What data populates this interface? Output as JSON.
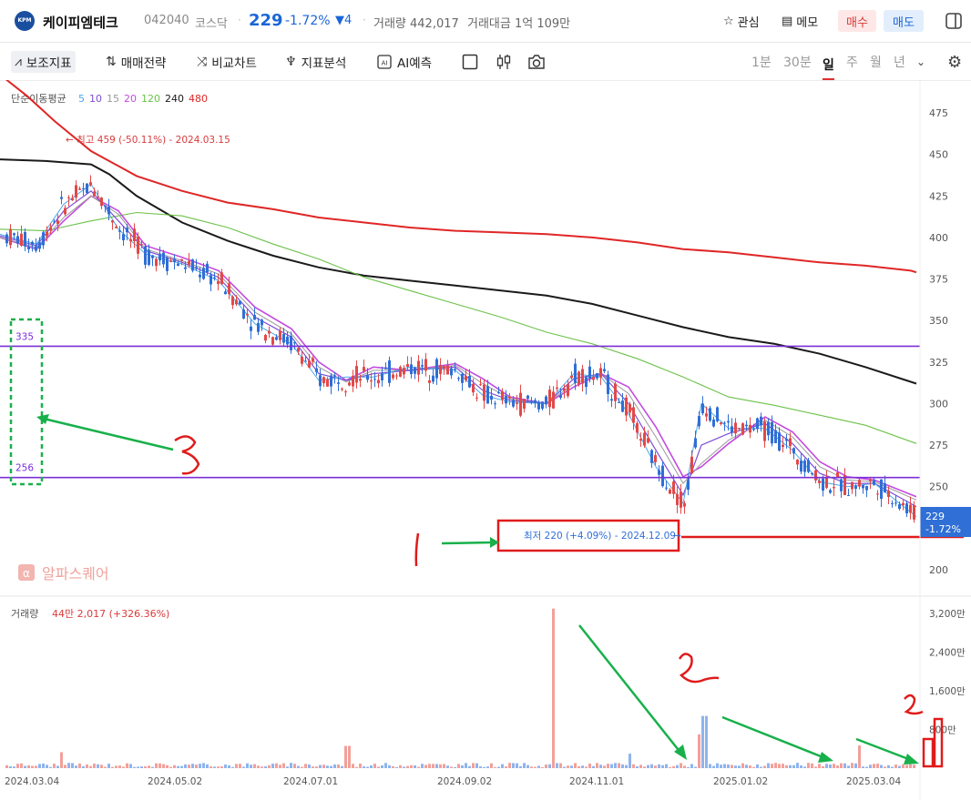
{
  "header": {
    "name": "케이피엠테크",
    "code": "042040",
    "market": "코스닥",
    "price": "229",
    "change_pct": "-1.72%",
    "change": "▼4",
    "volume_label": "거래량 442,017",
    "amount_label": "거래대금 1억 109만",
    "fav_label": "관심",
    "memo_label": "메모",
    "buy_label": "매수",
    "sell_label": "매도",
    "logo_text": "KPM"
  },
  "toolbar": {
    "indicators": "보조지표",
    "strategy": "매매전략",
    "compare": "비교차트",
    "analysis": "지표분석",
    "ai_predict": "AI예측",
    "periods": [
      "1분",
      "30분",
      "일",
      "주",
      "월",
      "년"
    ],
    "selected_period": "일"
  },
  "colors": {
    "up": "#e34848",
    "down": "#2f6fd6",
    "ma5": "#4aa8e8",
    "ma10": "#7c4dd8",
    "ma15": "#9a9a9a",
    "ma20": "#c34be0",
    "ma120": "#6cc24a",
    "ma240": "#1a1a1a",
    "ma480": "#e02626",
    "hline": "#7b2fd6"
  },
  "chart_data": {
    "type": "candlestick",
    "legend": {
      "title": "단순이동평균",
      "periods": [
        "5",
        "10",
        "15",
        "20",
        "120",
        "240",
        "480"
      ]
    },
    "y_ticks": [
      475,
      450,
      425,
      400,
      375,
      350,
      325,
      300,
      275,
      250,
      225,
      200
    ],
    "ylim": [
      186,
      484
    ],
    "x_ticks": [
      "2024.03.04",
      "2024.05.02",
      "2024.07.01",
      "2024.09.02",
      "2024.11.01",
      "2025.01.02",
      "2025.03.04"
    ],
    "high_label": "최고 459 (-50.11%) - 2024.03.15",
    "low_label": "최저 220 (+4.09%) - 2024.12.09",
    "last_price": "229",
    "last_pct": "-1.72%",
    "hlines": [
      {
        "label": "335",
        "value": 334.5
      },
      {
        "label": "256",
        "value": 255.5
      }
    ],
    "ma_series": [
      {
        "period": "480",
        "points": [
          [
            0,
            498
          ],
          [
            30,
            485
          ],
          [
            60,
            470
          ],
          [
            100,
            452
          ],
          [
            150,
            437
          ],
          [
            200,
            428
          ],
          [
            250,
            421
          ],
          [
            300,
            417
          ],
          [
            350,
            412
          ],
          [
            400,
            409
          ],
          [
            450,
            406
          ],
          [
            500,
            404
          ],
          [
            550,
            403
          ],
          [
            600,
            402
          ],
          [
            650,
            400
          ],
          [
            700,
            397
          ],
          [
            750,
            393
          ],
          [
            800,
            391
          ],
          [
            850,
            388
          ],
          [
            900,
            385
          ],
          [
            950,
            383
          ],
          [
            1000,
            380
          ],
          [
            1006,
            379
          ]
        ]
      },
      {
        "period": "240",
        "points": [
          [
            0,
            447
          ],
          [
            50,
            446
          ],
          [
            100,
            444
          ],
          [
            120,
            438
          ],
          [
            150,
            425
          ],
          [
            200,
            409
          ],
          [
            250,
            398
          ],
          [
            300,
            389
          ],
          [
            350,
            382
          ],
          [
            400,
            377
          ],
          [
            450,
            374
          ],
          [
            500,
            371
          ],
          [
            550,
            368
          ],
          [
            600,
            365
          ],
          [
            650,
            360
          ],
          [
            700,
            353
          ],
          [
            750,
            346
          ],
          [
            800,
            340
          ],
          [
            850,
            336
          ],
          [
            900,
            330
          ],
          [
            950,
            322
          ],
          [
            1006,
            312
          ]
        ]
      },
      {
        "period": "120",
        "points": [
          [
            0,
            405
          ],
          [
            50,
            404
          ],
          [
            100,
            410
          ],
          [
            150,
            415
          ],
          [
            200,
            413
          ],
          [
            250,
            406
          ],
          [
            300,
            396
          ],
          [
            350,
            387
          ],
          [
            400,
            376
          ],
          [
            450,
            368
          ],
          [
            500,
            360
          ],
          [
            550,
            352
          ],
          [
            600,
            343
          ],
          [
            650,
            336
          ],
          [
            700,
            327
          ],
          [
            750,
            316
          ],
          [
            800,
            304
          ],
          [
            850,
            299
          ],
          [
            900,
            293
          ],
          [
            950,
            287
          ],
          [
            1006,
            276
          ]
        ]
      },
      {
        "period": "20",
        "points": [
          [
            0,
            400
          ],
          [
            40,
            393
          ],
          [
            70,
            410
          ],
          [
            100,
            425
          ],
          [
            130,
            416
          ],
          [
            160,
            395
          ],
          [
            200,
            388
          ],
          [
            240,
            380
          ],
          [
            280,
            358
          ],
          [
            320,
            345
          ],
          [
            350,
            325
          ],
          [
            380,
            314
          ],
          [
            410,
            322
          ],
          [
            450,
            320
          ],
          [
            500,
            324
          ],
          [
            530,
            315
          ],
          [
            560,
            304
          ],
          [
            600,
            300
          ],
          [
            630,
            310
          ],
          [
            660,
            318
          ],
          [
            690,
            310
          ],
          [
            720,
            286
          ],
          [
            750,
            256
          ],
          [
            770,
            262
          ],
          [
            800,
            276
          ],
          [
            840,
            292
          ],
          [
            870,
            283
          ],
          [
            900,
            265
          ],
          [
            930,
            256
          ],
          [
            960,
            254
          ],
          [
            1006,
            244
          ]
        ]
      },
      {
        "period": "15",
        "points": [
          [
            0,
            400
          ],
          [
            40,
            394
          ],
          [
            70,
            412
          ],
          [
            100,
            425
          ],
          [
            130,
            414
          ],
          [
            160,
            393
          ],
          [
            200,
            386
          ],
          [
            240,
            378
          ],
          [
            280,
            355
          ],
          [
            320,
            342
          ],
          [
            350,
            322
          ],
          [
            380,
            313
          ],
          [
            410,
            320
          ],
          [
            450,
            320
          ],
          [
            500,
            323
          ],
          [
            530,
            312
          ],
          [
            560,
            303
          ],
          [
            600,
            300
          ],
          [
            630,
            312
          ],
          [
            660,
            318
          ],
          [
            690,
            306
          ],
          [
            720,
            280
          ],
          [
            750,
            252
          ],
          [
            770,
            264
          ],
          [
            800,
            278
          ],
          [
            840,
            290
          ],
          [
            870,
            280
          ],
          [
            900,
            262
          ],
          [
            930,
            254
          ],
          [
            960,
            253
          ],
          [
            1006,
            242
          ]
        ]
      },
      {
        "period": "10",
        "points": [
          [
            0,
            401
          ],
          [
            40,
            395
          ],
          [
            70,
            416
          ],
          [
            100,
            428
          ],
          [
            130,
            410
          ],
          [
            160,
            392
          ],
          [
            200,
            385
          ],
          [
            240,
            376
          ],
          [
            280,
            352
          ],
          [
            320,
            340
          ],
          [
            350,
            318
          ],
          [
            380,
            314
          ],
          [
            410,
            318
          ],
          [
            450,
            320
          ],
          [
            500,
            322
          ],
          [
            530,
            308
          ],
          [
            560,
            302
          ],
          [
            600,
            300
          ],
          [
            630,
            315
          ],
          [
            660,
            318
          ],
          [
            690,
            300
          ],
          [
            720,
            272
          ],
          [
            750,
            245
          ],
          [
            770,
            275
          ],
          [
            800,
            282
          ],
          [
            840,
            288
          ],
          [
            870,
            276
          ],
          [
            900,
            258
          ],
          [
            930,
            252
          ],
          [
            960,
            252
          ],
          [
            1006,
            238
          ]
        ]
      },
      {
        "period": "5",
        "points": [
          [
            0,
            402
          ],
          [
            40,
            396
          ],
          [
            70,
            420
          ],
          [
            100,
            432
          ],
          [
            130,
            405
          ],
          [
            160,
            390
          ],
          [
            200,
            384
          ],
          [
            240,
            374
          ],
          [
            280,
            348
          ],
          [
            320,
            336
          ],
          [
            350,
            314
          ],
          [
            380,
            316
          ],
          [
            410,
            316
          ],
          [
            450,
            322
          ],
          [
            500,
            320
          ],
          [
            530,
            305
          ],
          [
            560,
            301
          ],
          [
            600,
            300
          ],
          [
            630,
            318
          ],
          [
            660,
            316
          ],
          [
            690,
            294
          ],
          [
            720,
            262
          ],
          [
            750,
            240
          ],
          [
            770,
            300
          ],
          [
            800,
            285
          ],
          [
            840,
            285
          ],
          [
            870,
            272
          ],
          [
            900,
            253
          ],
          [
            930,
            250
          ],
          [
            960,
            252
          ],
          [
            1006,
            232
          ]
        ]
      }
    ],
    "volume": {
      "label": "거래량",
      "summary": "44만 2,017 (+326.36%)",
      "y_ticks": [
        "3,200만",
        "2,400만",
        "1,600만",
        "800만"
      ],
      "ylim": [
        0,
        3400
      ],
      "spikes": [
        {
          "x": 607,
          "value": 3300,
          "dir": "up"
        },
        {
          "x": 772,
          "value": 1080,
          "dir": "down"
        },
        {
          "x": 767,
          "value": 700,
          "dir": "up"
        },
        {
          "x": 380,
          "value": 460,
          "dir": "up"
        },
        {
          "x": 66,
          "value": 330,
          "dir": "up"
        },
        {
          "x": 690,
          "value": 300,
          "dir": "down"
        },
        {
          "x": 942,
          "value": 470,
          "dir": "up"
        }
      ]
    },
    "annotations": [
      {
        "text": "1"
      },
      {
        "text": "2"
      },
      {
        "text": "2"
      },
      {
        "text": "3"
      }
    ]
  },
  "watermark": "알파스퀘어"
}
